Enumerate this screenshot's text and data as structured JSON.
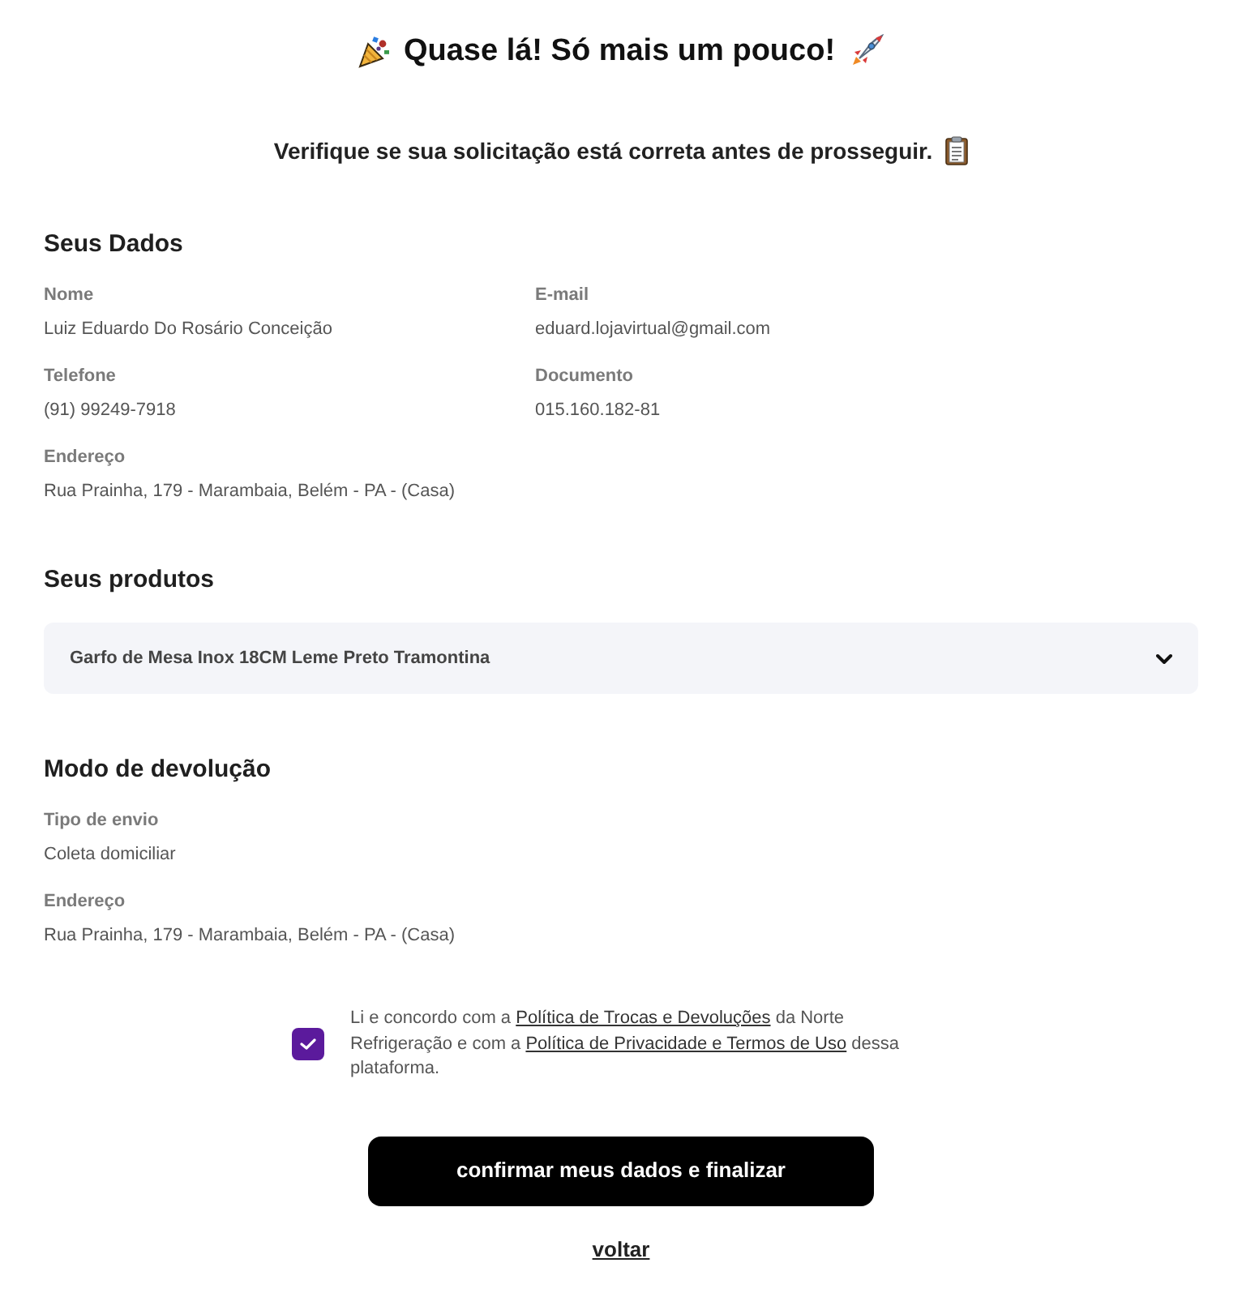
{
  "header": {
    "title": "Quase lá! Só mais um pouco!",
    "subtitle": "Verifique se sua solicitação está correta antes de prosseguir."
  },
  "sections": [
    {
      "kind": "details",
      "heading": "Seus Dados",
      "rows": [
        [
          {
            "label": "Nome",
            "value": "Luiz Eduardo Do Rosário Conceição"
          },
          {
            "label": "E-mail",
            "value": "eduard.lojavirtual@gmail.com"
          }
        ],
        [
          {
            "label": "Telefone",
            "value": "(91) 99249-7918"
          },
          {
            "label": "Documento",
            "value": "015.160.182-81"
          }
        ],
        [
          {
            "label": "Endereço",
            "value": "Rua Prainha, 179 - Marambaia, Belém - PA - (Casa)"
          }
        ]
      ]
    },
    {
      "kind": "products",
      "heading": "Seus produtos",
      "items": [
        {
          "name": "Garfo de Mesa Inox 18CM Leme Preto Tramontina",
          "expanded": false
        }
      ]
    },
    {
      "kind": "details",
      "heading": "Modo de devolução",
      "rows": [
        [
          {
            "label": "Tipo de envio",
            "value": "Coleta domiciliar"
          }
        ],
        [
          {
            "label": "Endereço",
            "value": "Rua Prainha, 179 - Marambaia, Belém - PA - (Casa)"
          }
        ]
      ]
    }
  ],
  "agreement": {
    "checked": true,
    "parts": [
      {
        "kind": "text",
        "text": "Li e concordo com a "
      },
      {
        "kind": "link",
        "text": "Política de Trocas e Devoluções"
      },
      {
        "kind": "text",
        "text": " da Norte Refrigeração e com a "
      },
      {
        "kind": "link",
        "text": "Política de Privacidade e Termos de Uso"
      },
      {
        "kind": "text",
        "text": " dessa plataforma."
      }
    ]
  },
  "actions": {
    "confirm": "confirmar meus dados e finalizar",
    "back": "voltar"
  }
}
